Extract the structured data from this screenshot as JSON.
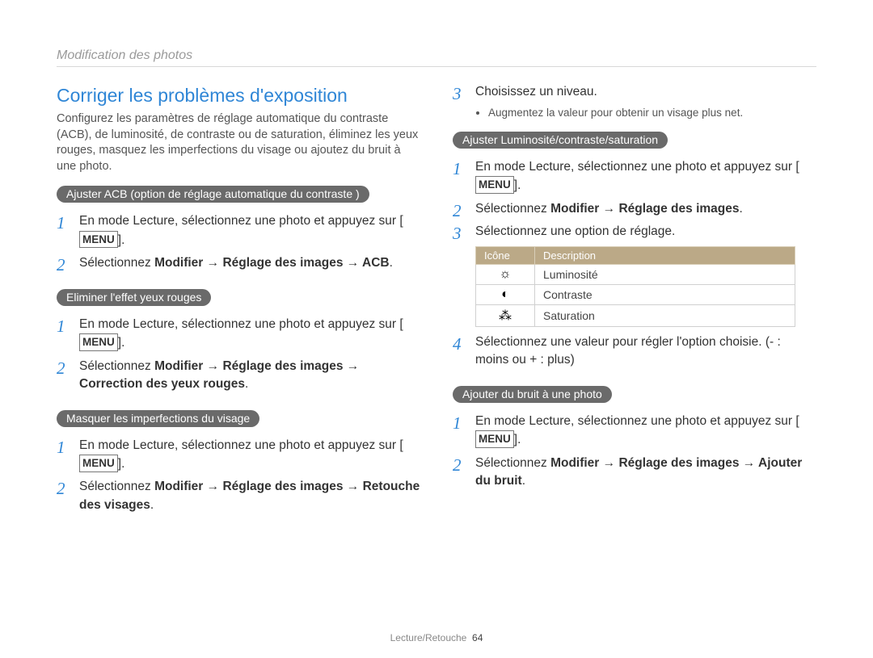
{
  "breadcrumb": "Modification des photos",
  "title": "Corriger les problèmes d'exposition",
  "intro": "Configurez les paramètres de réglage automatique du contraste (ACB), de luminosité, de contraste ou de saturation, éliminez les yeux rouges, masquez les imperfections du visage ou ajoutez du bruit à une photo.",
  "menu_label": "MENU",
  "sections": {
    "acb": {
      "pill": "Ajuster ACB (option de réglage automatique du contraste )",
      "step1a": "En mode Lecture, sélectionnez une photo et appuyez sur ",
      "step1b": ".",
      "step2a": "Sélectionnez ",
      "step2b": "Modifier → Réglage des images → ACB",
      "step2c": "."
    },
    "redeye": {
      "pill": "Eliminer l'effet yeux rouges",
      "step1a": "En mode Lecture, sélectionnez une photo et appuyez sur ",
      "step1b": ".",
      "step2a": "Sélectionnez ",
      "step2b": "Modifier → Réglage des images → Correction des yeux rouges",
      "step2c": "."
    },
    "face": {
      "pill": "Masquer les imperfections du visage",
      "step1a": "En mode Lecture, sélectionnez une photo et appuyez sur ",
      "step1b": ".",
      "step2a": "Sélectionnez ",
      "step2b": "Modifier → Réglage des images → Retouche des visages",
      "step2c": "."
    },
    "face_cont": {
      "step3": "Choisissez un niveau.",
      "bullet": "Augmentez la valeur pour obtenir un visage plus net."
    },
    "bcs": {
      "pill": "Ajuster Luminosité/contraste/saturation",
      "step1a": "En mode Lecture, sélectionnez une photo et appuyez sur ",
      "step1b": ".",
      "step2a": "Sélectionnez ",
      "step2b": "Modifier → Réglage des images",
      "step2c": ".",
      "step3": "Sélectionnez une option de réglage.",
      "table": {
        "col1": "Icône",
        "col2": "Description",
        "rows": [
          {
            "icon": "☼",
            "desc": "Luminosité"
          },
          {
            "icon": "◐",
            "desc": "Contraste"
          },
          {
            "icon": "⁂",
            "desc": "Saturation"
          }
        ]
      },
      "step4": "Sélectionnez une valeur pour régler l'option choisie. (- : moins ou + : plus)"
    },
    "noise": {
      "pill": "Ajouter du bruit à une photo",
      "step1a": "En mode Lecture, sélectionnez une photo et appuyez sur ",
      "step1b": ".",
      "step2a": "Sélectionnez ",
      "step2b": "Modifier → Réglage des images → Ajouter du bruit",
      "step2c": "."
    }
  },
  "footer": {
    "section": "Lecture/Retouche",
    "page": "64"
  },
  "icons": {
    "brightness": "brightness-icon",
    "contrast": "contrast-icon",
    "saturation": "saturation-icon"
  }
}
